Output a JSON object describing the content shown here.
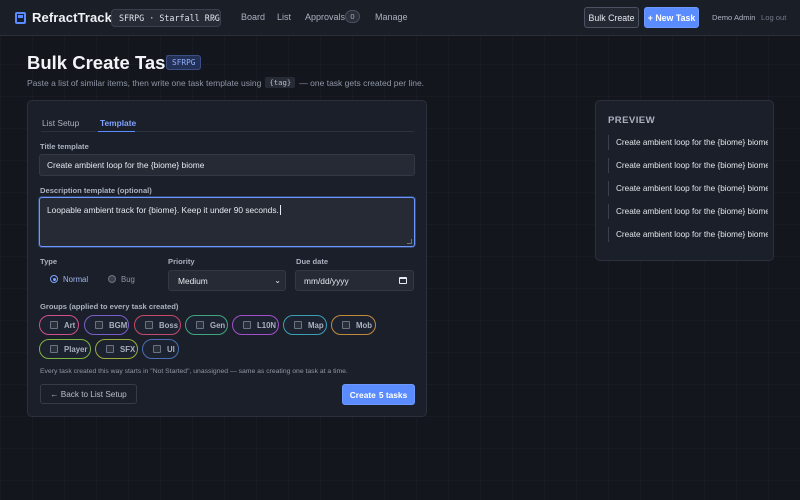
{
  "app": {
    "name": "RefractTrack",
    "project_selector": "SFRPG · Starfall RPG"
  },
  "nav": {
    "board": "Board",
    "list": "List",
    "approvals": "Approvals",
    "approvals_count": "0",
    "manage": "Manage"
  },
  "header_actions": {
    "bulk_create": "Bulk Create",
    "new_task": "+ New Task",
    "user": "Demo Admin",
    "logout": "Log out"
  },
  "page": {
    "title": "Bulk Create Tasks",
    "project_tag": "SFRPG",
    "subtitle_before": "Paste a list of similar items, then write one task template using",
    "subtitle_code": "{tag}",
    "subtitle_after": "— one task gets created per line."
  },
  "tabs": {
    "list_setup": "List Setup",
    "template": "Template",
    "active": "Template"
  },
  "form": {
    "title_label": "Title template",
    "title_value": "Create ambient loop for the {biome} biome",
    "description_label": "Description template (optional)",
    "description_value": "Loopable ambient track for {biome}. Keep it under 90 seconds.",
    "type_label": "Type",
    "type_options": [
      "Normal",
      "Bug"
    ],
    "type_selected": "Normal",
    "priority_label": "Priority",
    "priority_value": "Medium",
    "due_label": "Due date",
    "due_placeholder": "mm/dd/yyyy",
    "groups_label": "Groups (applied to every task created)",
    "groups": [
      {
        "name": "Art",
        "color": "#d04f8c"
      },
      {
        "name": "BGM",
        "color": "#7a5ec8"
      },
      {
        "name": "Boss",
        "color": "#c44a6a"
      },
      {
        "name": "Gen",
        "color": "#3fa67e"
      },
      {
        "name": "L10N",
        "color": "#a24fc9"
      },
      {
        "name": "Map",
        "color": "#3a9fb0"
      },
      {
        "name": "Mob",
        "color": "#c08a3c"
      },
      {
        "name": "Player",
        "color": "#7cb342"
      },
      {
        "name": "SFX",
        "color": "#9bab3a"
      },
      {
        "name": "UI",
        "color": "#4a6fb0"
      }
    ],
    "footnote": "Every task created this way starts in \"Not Started\", unassigned — same as creating one task at a time.",
    "back_button": "← Back to List Setup",
    "create_button_prefix": "Create",
    "create_button_count": "5 tasks"
  },
  "preview": {
    "title": "PREVIEW",
    "items": [
      "Create ambient loop for the {biome} biome",
      "Create ambient loop for the {biome} biome",
      "Create ambient loop for the {biome} biome",
      "Create ambient loop for the {biome} biome",
      "Create ambient loop for the {biome} biome"
    ]
  },
  "colors": {
    "accent": "#5b8cff",
    "background": "#13161d",
    "card": "#1b1f29"
  }
}
